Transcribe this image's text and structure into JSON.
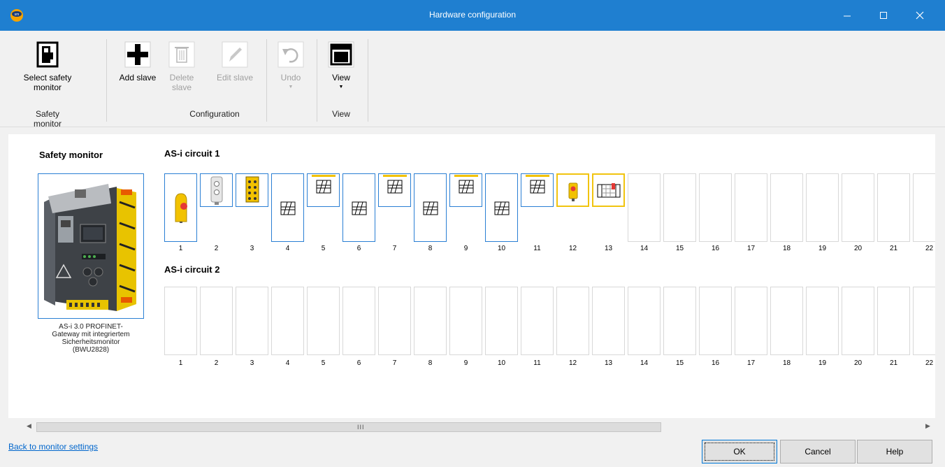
{
  "window": {
    "title": "Hardware configuration",
    "icon": "app-logo-icon",
    "controls": [
      "minimize-icon",
      "maximize-icon",
      "close-icon"
    ]
  },
  "ribbon": {
    "groups": [
      {
        "label": "Safety monitor",
        "buttons": [
          {
            "label_line1": "Select safety",
            "label_line2": "monitor",
            "icon": "safety-monitor-icon",
            "enabled": true
          }
        ]
      },
      {
        "label": "Configuration",
        "buttons": [
          {
            "label_line1": "Add slave",
            "label_line2": "",
            "icon": "plus-icon",
            "enabled": true
          },
          {
            "label_line1": "Delete",
            "label_line2": "slave",
            "icon": "trash-icon",
            "enabled": false
          },
          {
            "label_line1": "Edit slave",
            "label_line2": "",
            "icon": "pencil-icon",
            "enabled": false
          },
          {
            "label_line1": "Undo",
            "label_line2": "",
            "icon": "undo-icon",
            "enabled": false,
            "dropdown": true
          }
        ]
      },
      {
        "label": "View",
        "buttons": [
          {
            "label_line1": "View",
            "label_line2": "",
            "icon": "view-layout-icon",
            "enabled": true,
            "dropdown": true
          }
        ]
      }
    ]
  },
  "safety_monitor": {
    "title": "Safety monitor",
    "caption_line1": "AS-i 3.0 PROFINET-",
    "caption_line2": "Gateway mit integriertem",
    "caption_line3": "Sicherheitsmonitor",
    "caption_line4": "(BWU2828)"
  },
  "circuits": [
    {
      "title": "AS-i circuit 1",
      "slots": [
        {
          "number": "1",
          "device": "yellow-emergency-stop-icon"
        },
        {
          "number": "2",
          "device": "gray-sensor-module-icon"
        },
        {
          "number": "3",
          "device": "yellow-io-module-icon"
        },
        {
          "number": "4",
          "device": "hatched-slave-icon"
        },
        {
          "number": "5",
          "device": "hatched-slave-bar-icon"
        },
        {
          "number": "6",
          "device": "hatched-slave-icon"
        },
        {
          "number": "7",
          "device": "hatched-slave-bar-icon"
        },
        {
          "number": "8",
          "device": "hatched-slave-icon"
        },
        {
          "number": "9",
          "device": "hatched-slave-bar-icon"
        },
        {
          "number": "10",
          "device": "hatched-slave-icon"
        },
        {
          "number": "11",
          "device": "hatched-slave-bar-icon"
        },
        {
          "number": "12",
          "device": "yellow-button-module-icon"
        },
        {
          "number": "13",
          "device": "safety-light-grid-icon"
        },
        {
          "number": "14",
          "device": ""
        },
        {
          "number": "15",
          "device": ""
        },
        {
          "number": "16",
          "device": ""
        },
        {
          "number": "17",
          "device": ""
        },
        {
          "number": "18",
          "device": ""
        },
        {
          "number": "19",
          "device": ""
        },
        {
          "number": "20",
          "device": ""
        },
        {
          "number": "21",
          "device": ""
        },
        {
          "number": "22",
          "device": ""
        }
      ]
    },
    {
      "title": "AS-i circuit 2",
      "slots": [
        {
          "number": "1"
        },
        {
          "number": "2"
        },
        {
          "number": "3"
        },
        {
          "number": "4"
        },
        {
          "number": "5"
        },
        {
          "number": "6"
        },
        {
          "number": "7"
        },
        {
          "number": "8"
        },
        {
          "number": "9"
        },
        {
          "number": "10"
        },
        {
          "number": "11"
        },
        {
          "number": "12"
        },
        {
          "number": "13"
        },
        {
          "number": "14"
        },
        {
          "number": "15"
        },
        {
          "number": "16"
        },
        {
          "number": "17"
        },
        {
          "number": "18"
        },
        {
          "number": "19"
        },
        {
          "number": "20"
        },
        {
          "number": "21"
        },
        {
          "number": "22"
        }
      ]
    }
  ],
  "scrollbar": {
    "grip": "III"
  },
  "footer": {
    "back_link": "Back to monitor settings",
    "ok": "OK",
    "cancel": "Cancel",
    "help": "Help"
  },
  "colors": {
    "title_bar": "#1f7fd0",
    "selection_border": "#2a7fd4",
    "highlight_border": "#f1c40f",
    "link": "#0066cc"
  }
}
